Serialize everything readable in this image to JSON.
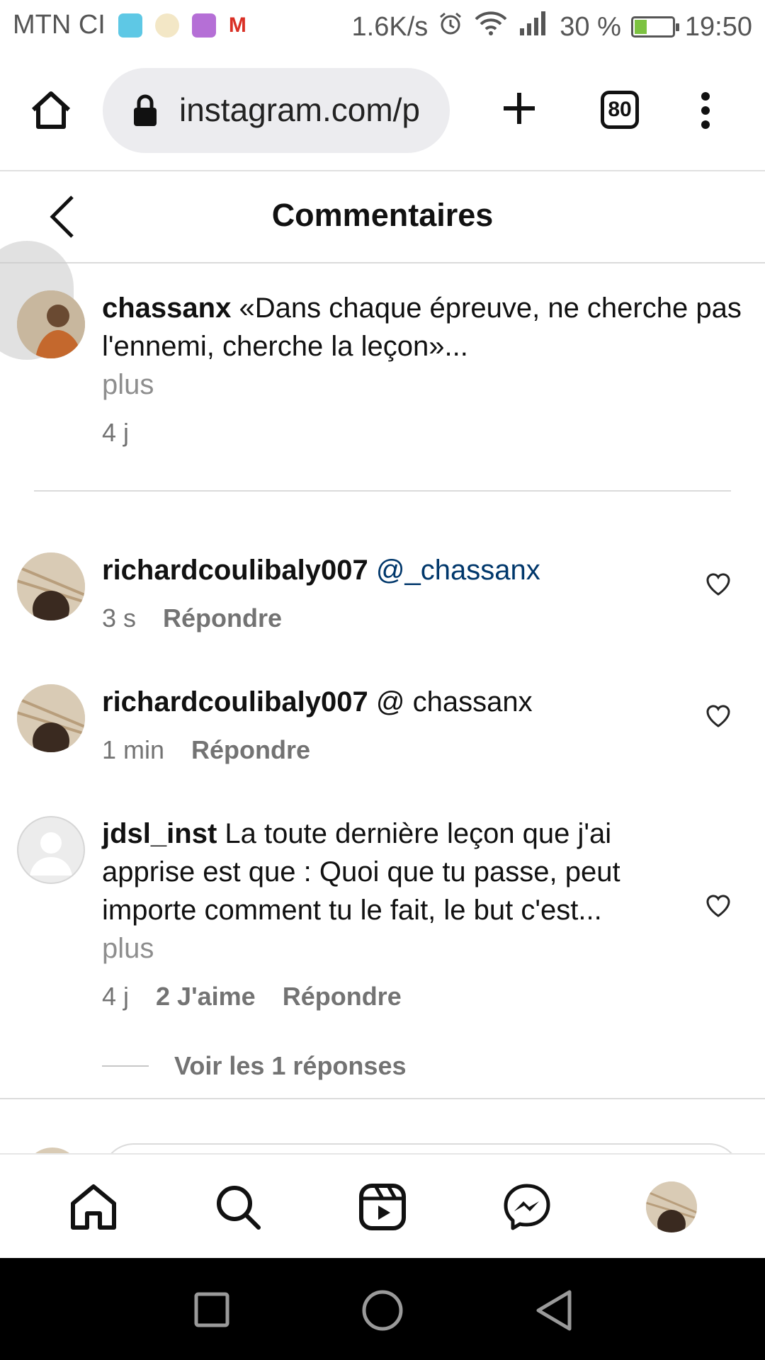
{
  "status_bar": {
    "carrier": "MTN CI",
    "speed": "1.6K/s",
    "battery_percent": "30 %",
    "battery_level": 0.3,
    "time": "19:50"
  },
  "browser": {
    "url": "instagram.com/p",
    "tab_count": "80"
  },
  "header": {
    "title": "Commentaires"
  },
  "caption": {
    "username": "chassanx",
    "text": "«Dans chaque épreuve, ne cherche pas l'ennemi, cherche la leçon»...",
    "more": "plus",
    "time": "4 j"
  },
  "comments": [
    {
      "username": "richardcoulibaly007",
      "text": "@_chassanx",
      "time": "3 s",
      "reply": "Répondre"
    },
    {
      "username": "richardcoulibaly007",
      "text": "@ chassanx",
      "time": "1 min",
      "reply": "Répondre"
    },
    {
      "username": "jdsl_inst",
      "text": "La toute dernière leçon que j'ai apprise est que : Quoi que tu passe, peut importe comment tu le fait, le but c'est...",
      "more": "plus",
      "time": "4 j",
      "likes": "2 J'aime",
      "reply": "Répondre",
      "view_replies": "Voir les 1 réponses"
    }
  ],
  "colors": {
    "mention": "#00376b",
    "secondary_text": "#737373",
    "divider": "#dbdbdb"
  }
}
